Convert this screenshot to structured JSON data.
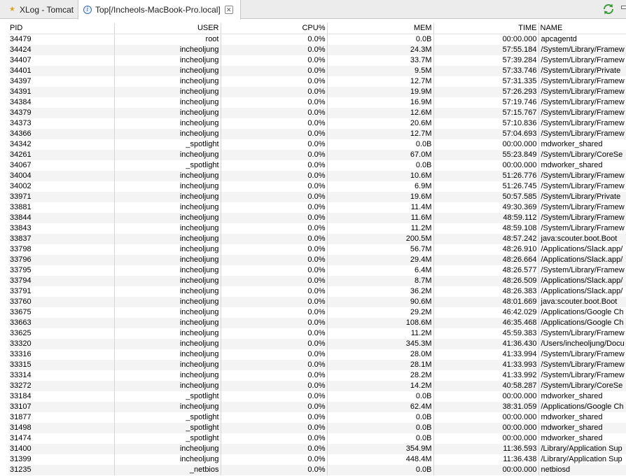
{
  "tabs": [
    {
      "label": "XLog - Tomcat",
      "icon": "star-icon"
    },
    {
      "label": "Top[/Incheols-MacBook-Pro.local]",
      "icon": "info-icon"
    }
  ],
  "colors": {
    "tab_bar_bg": "#ececec",
    "row_alt_bg": "#f4f4f4",
    "refresh_icon": "#3a9a3a"
  },
  "table": {
    "columns": [
      "PID",
      "USER",
      "CPU%",
      "MEM",
      "TIME",
      "NAME"
    ],
    "rows": [
      [
        "34479",
        "root",
        "0.0%",
        "0.0B",
        "00:00.000",
        "apcagentd"
      ],
      [
        "34424",
        "incheoljung",
        "0.0%",
        "24.3M",
        "57:55.184",
        "/System/Library/Framew"
      ],
      [
        "34407",
        "incheoljung",
        "0.0%",
        "33.7M",
        "57:39.284",
        "/System/Library/Framew"
      ],
      [
        "34401",
        "incheoljung",
        "0.0%",
        "9.5M",
        "57:33.746",
        "/System/Library/Private"
      ],
      [
        "34397",
        "incheoljung",
        "0.0%",
        "12.7M",
        "57:31.335",
        "/System/Library/Framew"
      ],
      [
        "34391",
        "incheoljung",
        "0.0%",
        "19.9M",
        "57:26.293",
        "/System/Library/Framew"
      ],
      [
        "34384",
        "incheoljung",
        "0.0%",
        "16.9M",
        "57:19.746",
        "/System/Library/Framew"
      ],
      [
        "34379",
        "incheoljung",
        "0.0%",
        "12.6M",
        "57:15.767",
        "/System/Library/Framew"
      ],
      [
        "34373",
        "incheoljung",
        "0.0%",
        "20.6M",
        "57:10.836",
        "/System/Library/Framew"
      ],
      [
        "34366",
        "incheoljung",
        "0.0%",
        "12.7M",
        "57:04.693",
        "/System/Library/Framew"
      ],
      [
        "34342",
        "_spotlight",
        "0.0%",
        "0.0B",
        "00:00.000",
        "mdworker_shared"
      ],
      [
        "34261",
        "incheoljung",
        "0.0%",
        "67.0M",
        "55:23.849",
        "/System/Library/CoreSe"
      ],
      [
        "34067",
        "_spotlight",
        "0.0%",
        "0.0B",
        "00:00.000",
        "mdworker_shared"
      ],
      [
        "34004",
        "incheoljung",
        "0.0%",
        "10.6M",
        "51:26.776",
        "/System/Library/Framew"
      ],
      [
        "34002",
        "incheoljung",
        "0.0%",
        "6.9M",
        "51:26.745",
        "/System/Library/Framew"
      ],
      [
        "33971",
        "incheoljung",
        "0.0%",
        "19.6M",
        "50:57.585",
        "/System/Library/Private"
      ],
      [
        "33881",
        "incheoljung",
        "0.0%",
        "11.4M",
        "49:30.369",
        "/System/Library/Framew"
      ],
      [
        "33844",
        "incheoljung",
        "0.0%",
        "11.6M",
        "48:59.112",
        "/System/Library/Framew"
      ],
      [
        "33843",
        "incheoljung",
        "0.0%",
        "11.2M",
        "48:59.108",
        "/System/Library/Framew"
      ],
      [
        "33837",
        "incheoljung",
        "0.0%",
        "200.5M",
        "48:57.242",
        "java:scouter.boot.Boot"
      ],
      [
        "33798",
        "incheoljung",
        "0.0%",
        "56.7M",
        "48:26.910",
        "/Applications/Slack.app/"
      ],
      [
        "33796",
        "incheoljung",
        "0.0%",
        "29.4M",
        "48:26.664",
        "/Applications/Slack.app/"
      ],
      [
        "33795",
        "incheoljung",
        "0.0%",
        "6.4M",
        "48:26.577",
        "/System/Library/Framew"
      ],
      [
        "33794",
        "incheoljung",
        "0.0%",
        "8.7M",
        "48:26.509",
        "/Applications/Slack.app/"
      ],
      [
        "33791",
        "incheoljung",
        "0.0%",
        "36.2M",
        "48:26.383",
        "/Applications/Slack.app/"
      ],
      [
        "33760",
        "incheoljung",
        "0.0%",
        "90.6M",
        "48:01.669",
        "java:scouter.boot.Boot"
      ],
      [
        "33675",
        "incheoljung",
        "0.0%",
        "29.2M",
        "46:42.029",
        "/Applications/Google Ch"
      ],
      [
        "33663",
        "incheoljung",
        "0.0%",
        "108.6M",
        "46:35.468",
        "/Applications/Google Ch"
      ],
      [
        "33625",
        "incheoljung",
        "0.0%",
        "11.2M",
        "45:59.383",
        "/System/Library/Framew"
      ],
      [
        "33320",
        "incheoljung",
        "0.0%",
        "345.3M",
        "41:36.430",
        "/Users/incheoljung/Docu"
      ],
      [
        "33316",
        "incheoljung",
        "0.0%",
        "28.0M",
        "41:33.994",
        "/System/Library/Framew"
      ],
      [
        "33315",
        "incheoljung",
        "0.0%",
        "28.1M",
        "41:33.993",
        "/System/Library/Framew"
      ],
      [
        "33314",
        "incheoljung",
        "0.0%",
        "28.2M",
        "41:33.992",
        "/System/Library/Framew"
      ],
      [
        "33272",
        "incheoljung",
        "0.0%",
        "14.2M",
        "40:58.287",
        "/System/Library/CoreSe"
      ],
      [
        "33184",
        "_spotlight",
        "0.0%",
        "0.0B",
        "00:00.000",
        "mdworker_shared"
      ],
      [
        "33107",
        "incheoljung",
        "0.0%",
        "62.4M",
        "38:31.059",
        "/Applications/Google Ch"
      ],
      [
        "31877",
        "_spotlight",
        "0.0%",
        "0.0B",
        "00:00.000",
        "mdworker_shared"
      ],
      [
        "31498",
        "_spotlight",
        "0.0%",
        "0.0B",
        "00:00.000",
        "mdworker_shared"
      ],
      [
        "31474",
        "_spotlight",
        "0.0%",
        "0.0B",
        "00:00.000",
        "mdworker_shared"
      ],
      [
        "31400",
        "incheoljung",
        "0.0%",
        "354.9M",
        "11:36.593",
        "/Library/Application Sup"
      ],
      [
        "31399",
        "incheoljung",
        "0.0%",
        "448.4M",
        "11:36.438",
        "/Library/Application Sup"
      ],
      [
        "31235",
        "_netbios",
        "0.0%",
        "0.0B",
        "00:00.000",
        "netbiosd"
      ]
    ]
  }
}
